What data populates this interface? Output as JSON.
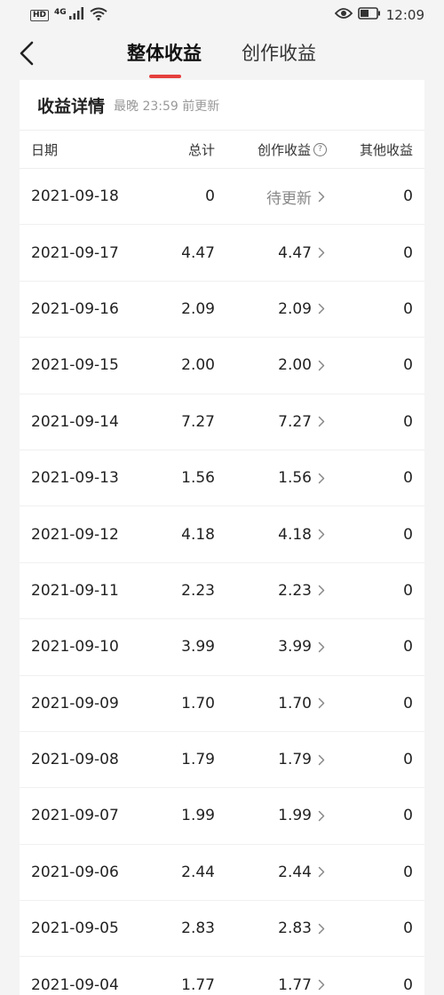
{
  "status_bar": {
    "hd": "HD",
    "network": "4G",
    "time": "12:09",
    "icons": [
      "signal-icon",
      "wifi-icon",
      "eye-icon",
      "battery-icon"
    ]
  },
  "header": {
    "tabs": [
      {
        "label": "整体收益",
        "active": true
      },
      {
        "label": "创作收益",
        "active": false
      }
    ],
    "accent_color": "#e5403d"
  },
  "card": {
    "title": "收益详情",
    "updated": "最晚 23:59 前更新",
    "columns": {
      "date": "日期",
      "total": "总计",
      "creation": "创作收益",
      "other": "其他收益"
    },
    "rows": [
      {
        "date": "2021-09-18",
        "total": "0",
        "creation": "待更新",
        "other": "0"
      },
      {
        "date": "2021-09-17",
        "total": "4.47",
        "creation": "4.47",
        "other": "0"
      },
      {
        "date": "2021-09-16",
        "total": "2.09",
        "creation": "2.09",
        "other": "0"
      },
      {
        "date": "2021-09-15",
        "total": "2.00",
        "creation": "2.00",
        "other": "0"
      },
      {
        "date": "2021-09-14",
        "total": "7.27",
        "creation": "7.27",
        "other": "0"
      },
      {
        "date": "2021-09-13",
        "total": "1.56",
        "creation": "1.56",
        "other": "0"
      },
      {
        "date": "2021-09-12",
        "total": "4.18",
        "creation": "4.18",
        "other": "0"
      },
      {
        "date": "2021-09-11",
        "total": "2.23",
        "creation": "2.23",
        "other": "0"
      },
      {
        "date": "2021-09-10",
        "total": "3.99",
        "creation": "3.99",
        "other": "0"
      },
      {
        "date": "2021-09-09",
        "total": "1.70",
        "creation": "1.70",
        "other": "0"
      },
      {
        "date": "2021-09-08",
        "total": "1.79",
        "creation": "1.79",
        "other": "0"
      },
      {
        "date": "2021-09-07",
        "total": "1.99",
        "creation": "1.99",
        "other": "0"
      },
      {
        "date": "2021-09-06",
        "total": "2.44",
        "creation": "2.44",
        "other": "0"
      },
      {
        "date": "2021-09-05",
        "total": "2.83",
        "creation": "2.83",
        "other": "0"
      },
      {
        "date": "2021-09-04",
        "total": "1.77",
        "creation": "1.77",
        "other": "0"
      }
    ]
  }
}
